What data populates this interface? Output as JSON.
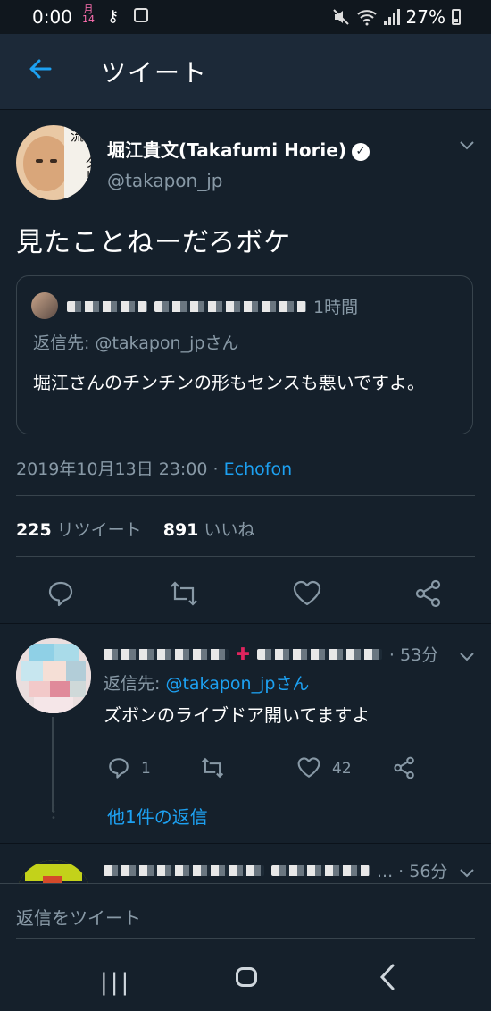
{
  "status_bar": {
    "time": "0:00",
    "calendar_month": "月",
    "calendar_day": "14",
    "battery": "27%"
  },
  "header": {
    "title": "ツイート"
  },
  "tweet": {
    "display_name": "堀江貴文(Takafumi Horie)",
    "handle": "@takapon_jp",
    "avatar_text": "ハッタリの流",
    "text": "見たことねーだろボケ",
    "quoted": {
      "time": "1時間",
      "reply_to": "返信先: @takapon_jpさん",
      "text": "堀江さんのチンチンの形もセンスも悪いですよ。"
    },
    "timestamp": "2019年10月13日 23:00",
    "separator": " · ",
    "source": "Echofon",
    "retweet_count": "225",
    "retweet_label": "リツイート",
    "like_count": "891",
    "like_label": "いいね"
  },
  "replies": [
    {
      "time": "· 53分",
      "reply_prefix": "返信先: ",
      "reply_handle": "@takapon_jpさん",
      "text": "ズボンのライブドア開いてますよ",
      "reply_count": "1",
      "like_count": "42",
      "more_replies": "他1件の返信"
    },
    {
      "time": "... · 56分"
    }
  ],
  "compose": {
    "placeholder": "返信をツイート"
  },
  "colors": {
    "background": "#15202b",
    "accent": "#1da1f2",
    "secondary_text": "#8899a6",
    "border": "#38444d"
  }
}
